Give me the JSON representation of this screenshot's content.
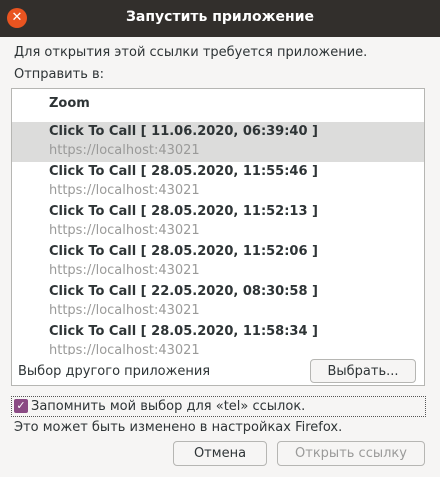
{
  "window": {
    "title": "Запустить приложение",
    "close_symbol": "✕"
  },
  "dialog": {
    "description": "Для открытия этой ссылки требуется приложение.",
    "send_to_label": "Отправить в:",
    "list": {
      "header_item": "Zoom",
      "items": [
        {
          "title": "Click To Call [ 11.06.2020, 06:39:40 ]",
          "url": "https://localhost:43021",
          "selected": true
        },
        {
          "title": "Click To Call [ 28.05.2020, 11:55:46 ]",
          "url": "https://localhost:43021",
          "selected": false
        },
        {
          "title": "Click To Call [ 28.05.2020, 11:52:13 ]",
          "url": "https://localhost:43021",
          "selected": false
        },
        {
          "title": "Click To Call [ 28.05.2020, 11:52:06 ]",
          "url": "https://localhost:43021",
          "selected": false
        },
        {
          "title": "Click To Call [ 22.05.2020, 08:30:58 ]",
          "url": "https://localhost:43021",
          "selected": false
        },
        {
          "title": "Click To Call [ 28.05.2020, 11:58:34 ]",
          "url": "https://localhost:43021",
          "selected": false
        }
      ]
    },
    "other_app_label": "Выбор другого приложения",
    "choose_button": "Выбрать...",
    "remember_checkbox": {
      "label": "Запомнить мой выбор для «tel» ссылок.",
      "checked": true,
      "check_symbol": "✓"
    },
    "note": "Это может быть изменено в настройках Firefox.",
    "cancel_button": "Отмена",
    "open_button": "Открыть ссылку"
  },
  "colors": {
    "titlebar": "#322f2c",
    "close_button": "#e95420",
    "checkbox": "#8a4a83",
    "selected_row": "#dcdcdb"
  }
}
